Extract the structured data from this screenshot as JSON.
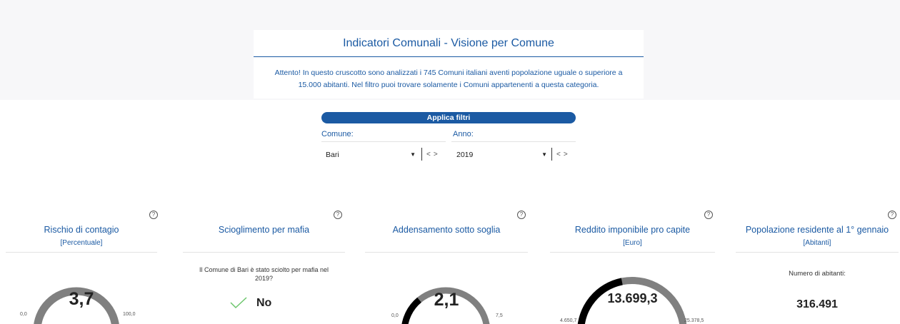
{
  "header": {
    "title": "Indicatori Comunali - Visione per Comune",
    "notice_line1": "Attento! In questo cruscotto sono analizzati i 745 Comuni italiani aventi popolazione uguale o superiore a",
    "notice_line2": "15.000 abitanti. Nel filtro puoi trovare solamente i Comuni appartenenti a questa categoria."
  },
  "filters": {
    "button_label": "Applica filtri",
    "comune": {
      "label": "Comune:",
      "value": "Bari",
      "arrow": "▼",
      "prev": "<",
      "next": ">"
    },
    "anno": {
      "label": "Anno:",
      "value": "2019",
      "arrow": "▼",
      "prev": "<",
      "next": ">"
    }
  },
  "help_glyph": "?",
  "kpis": {
    "contagio": {
      "title": "Rischio di contagio",
      "unit": "[Percentuale]",
      "value": "3,7",
      "min": "0,0",
      "max": "100,0",
      "fraction": 0.037
    },
    "mafia": {
      "title": "Scioglimento per mafia",
      "question_line1": "Il Comune di Bari è stato sciolto per mafia nel",
      "question_line2": "2019?",
      "answer": "No",
      "icon": "check-icon"
    },
    "addensamento": {
      "title": "Addensamento sotto soglia",
      "value": "2,1",
      "min": "0,0",
      "max": "7,5",
      "fraction": 0.28
    },
    "reddito": {
      "title": "Reddito imponibile pro capite",
      "unit": "[Euro]",
      "value": "13.699,3",
      "min": "4.650,7",
      "max": "25.378,5",
      "fraction": 0.4366
    },
    "popolazione": {
      "title": "Popolazione residente al 1° gennaio",
      "unit": "[Abitanti]",
      "label": "Numero di abitanti:",
      "value": "316.491"
    }
  },
  "colors": {
    "accent": "#1b5aa3",
    "gauge_track": "#808080",
    "gauge_fill": "#000000",
    "check": "#6cc66c"
  }
}
